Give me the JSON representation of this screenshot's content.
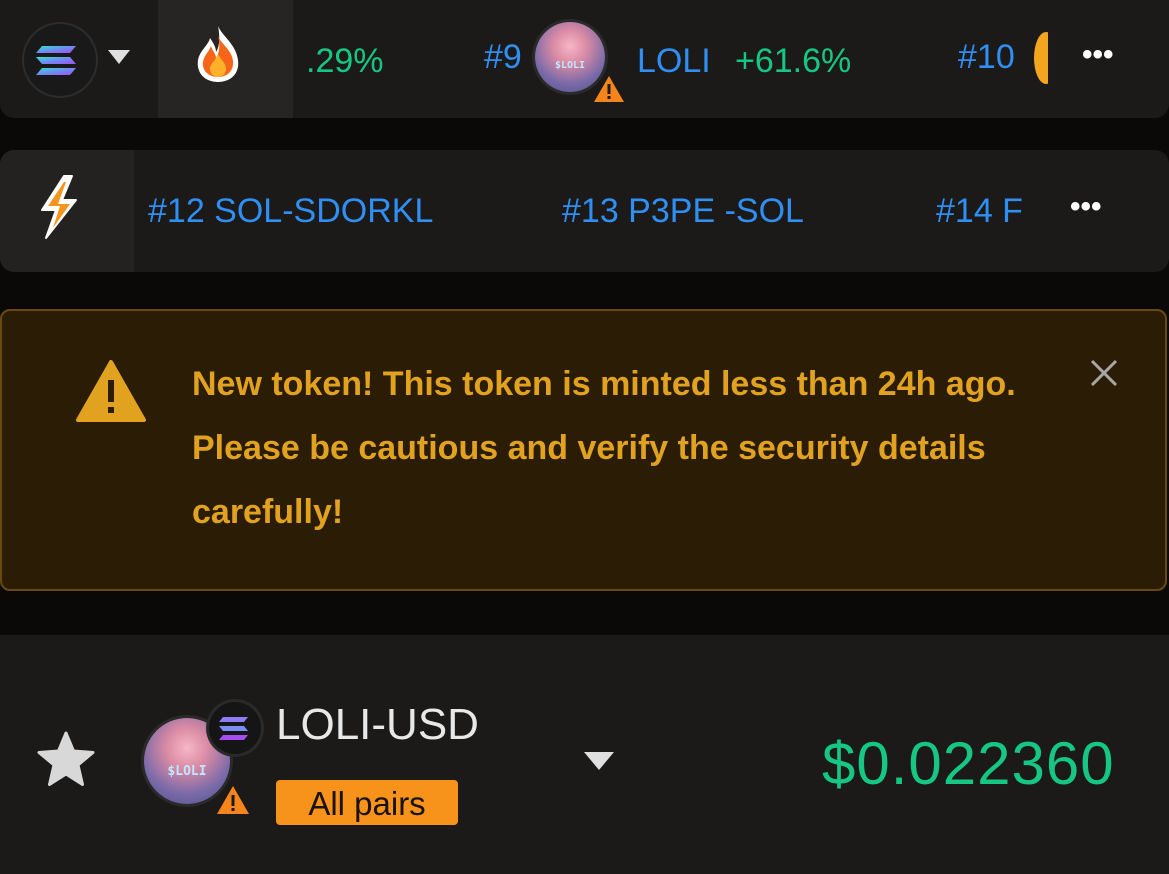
{
  "trending_bar": {
    "items": [
      {
        "text": ".29%"
      },
      {
        "rank": "#9",
        "avatar_text": "$LOLI",
        "name": "LOLI",
        "change": "+61.6%"
      },
      {
        "rank": "#10"
      }
    ],
    "more_label": "•••"
  },
  "new_pairs_bar": {
    "items": [
      {
        "text": "#12 SOL-SDORKL"
      },
      {
        "text": "#13 P3PE -SOL"
      },
      {
        "text": "#14 F"
      }
    ],
    "more_label": "•••"
  },
  "warning": {
    "message": "New token! This token is minted less than 24h ago. Please be cautious and verify the security details carefully!",
    "color": "#e1a220"
  },
  "pair": {
    "avatar_text": "$LOLI",
    "name": "LOLI-USD",
    "badge": "All pairs",
    "price": "$0.022360"
  },
  "colors": {
    "positive": "#16c784",
    "link": "#2f8ff4",
    "accent": "#f7931a",
    "warning_bg": "#2b1d05"
  },
  "icons": [
    "solana-icon",
    "chevron-down-icon",
    "fire-icon",
    "warning-icon",
    "bolt-icon",
    "more-icon",
    "close-icon",
    "star-icon"
  ]
}
